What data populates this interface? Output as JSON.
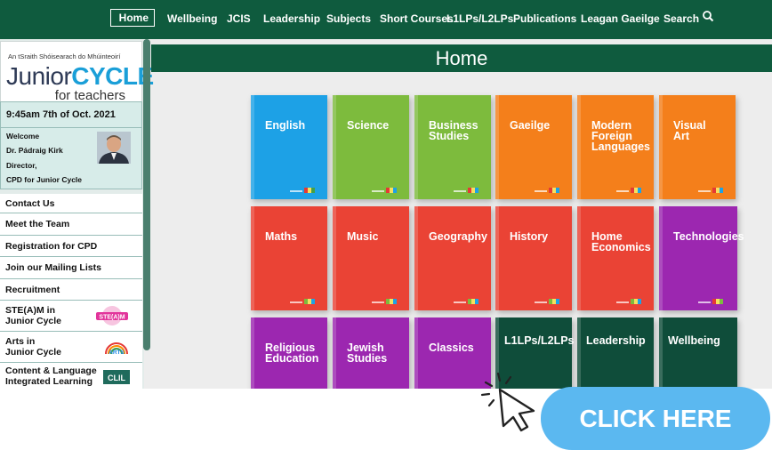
{
  "nav": {
    "home": "Home",
    "items": [
      "Wellbeing",
      "JCIS",
      "Leadership",
      "Subjects",
      "Short Courses",
      "L1LPs/L2LPs",
      "Publications",
      "Leagan Gaeilge",
      "Search"
    ]
  },
  "sidebar": {
    "tagline": "An tSraith Shóisearach do Mhúinteoirí",
    "logo_text": "Junior",
    "logo_text_bold": "CYCLE",
    "logo_sub": "for teachers",
    "datetime": "9:45am  7th of Oct. 2021",
    "welcome": [
      "Welcome",
      "Dr. Pádraig Kirk",
      "Director,",
      "CPD for Junior Cycle"
    ],
    "links": [
      "Contact Us",
      "Meet the Team",
      "Registration for CPD",
      "Join our Mailing Lists",
      "Recruitment"
    ],
    "badge_links": [
      {
        "l1": "STE(A)M in",
        "l2": "Junior Cycle",
        "badge": "STE(A)M"
      },
      {
        "l1": "Arts in",
        "l2": "Junior Cycle",
        "badge": "ARTS"
      },
      {
        "l1": "Content & Language",
        "l2": "Integrated Learning",
        "badge": "CLIL"
      }
    ]
  },
  "main": {
    "title": "Home",
    "tiles": [
      {
        "l1": "English",
        "l2": "",
        "l3": ""
      },
      {
        "l1": "Science",
        "l2": "",
        "l3": ""
      },
      {
        "l1": "Business",
        "l2": "Studies",
        "l3": ""
      },
      {
        "l1": "Gaeilge",
        "l2": "",
        "l3": ""
      },
      {
        "l1": "Modern",
        "l2": "Foreign",
        "l3": "Languages"
      },
      {
        "l1": "Visual",
        "l2": "Art",
        "l3": ""
      },
      {
        "l1": "Maths",
        "l2": "",
        "l3": ""
      },
      {
        "l1": "Music",
        "l2": "",
        "l3": ""
      },
      {
        "l1": "Geography",
        "l2": "",
        "l3": ""
      },
      {
        "l1": "History",
        "l2": "",
        "l3": ""
      },
      {
        "l1": "Home",
        "l2": "Economics",
        "l3": ""
      },
      {
        "l1": "Technologies",
        "l2": "",
        "l3": ""
      },
      {
        "l1": "Religious",
        "l2": "Education",
        "l3": ""
      },
      {
        "l1": "Jewish",
        "l2": "Studies",
        "l3": ""
      },
      {
        "l1": "Classics",
        "l2": "",
        "l3": ""
      },
      {
        "l1": "L1LPs/L2LPs",
        "l2": "",
        "l3": ""
      },
      {
        "l1": "Leadership",
        "l2": "",
        "l3": ""
      },
      {
        "l1": "Wellbeing",
        "l2": "",
        "l3": ""
      }
    ]
  },
  "colors": {
    "green_dark": "#0f5b3e",
    "blue": "#1da1e6",
    "light_green": "#7dbb3d",
    "orange": "#f47f1b",
    "red": "#ea4335",
    "purple": "#9c27b0",
    "teal_dark": "#0f4d3a",
    "cta_blue": "#5bb8f0"
  },
  "overlay": {
    "cta": "CLICK HERE"
  }
}
